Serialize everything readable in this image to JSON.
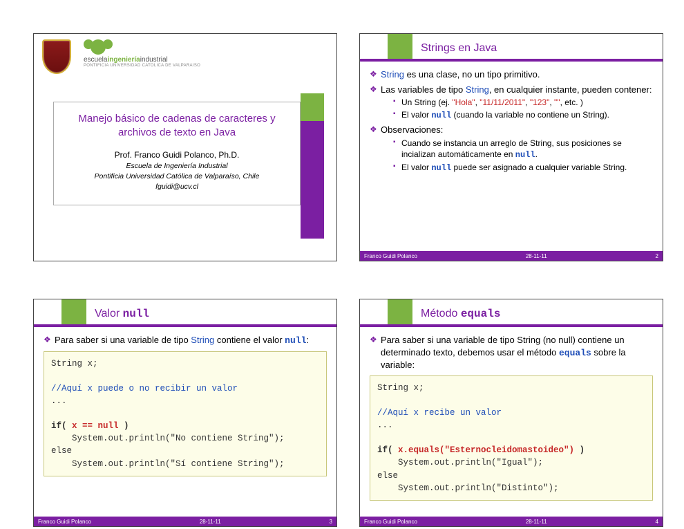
{
  "slide1": {
    "logo_text_prefix": "escuela",
    "logo_text_hi": "ingeniería",
    "logo_text_suffix": "industrial",
    "logo_sub": "PONTIFICIA UNIVERSIDAD CATOLICA DE VALPARAISO",
    "title_line1": "Manejo básico de cadenas de caracteres y",
    "title_line2": "archivos de texto en Java",
    "author": "Prof. Franco Guidi Polanco, Ph.D.",
    "aff1": "Escuela de Ingeniería Industrial",
    "aff2": "Pontificia Universidad Católica de Valparaíso, Chile",
    "email": "fguidi@ucv.cl"
  },
  "slide2": {
    "title": "Strings en Java",
    "b1_pre": "String",
    "b1_post": " es una clase, no un tipo primitivo.",
    "b2_pre": "Las variables de tipo ",
    "b2_mid": "String",
    "b2_post": ", en cualquier instante, pueden contener:",
    "b2s1_pre": "Un String (ej. ",
    "b2s1_q1": "\"Hola\"",
    "b2s1_sep1": ", ",
    "b2s1_q2": "\"11/11/2011\"",
    "b2s1_sep2": ", ",
    "b2s1_q3": "\"123\"",
    "b2s1_sep3": ", ",
    "b2s1_q4": "\"\"",
    "b2s1_post": ", etc. )",
    "b2s2_pre": "El valor ",
    "b2s2_code": "null",
    "b2s2_post": " (cuando la variable no contiene un String).",
    "b3": "Observaciones:",
    "b3s1_pre": "Cuando se instancia un arreglo de String, sus posiciones se incializan automáticamente en ",
    "b3s1_code": "null",
    "b3s1_post": ".",
    "b3s2_pre": "El valor ",
    "b3s2_code": "null",
    "b3s2_post": " puede ser asignado a cualquier variable String."
  },
  "slide3": {
    "title_pre": "Valor ",
    "title_code": "null",
    "b1_pre": "Para saber si una variable de tipo ",
    "b1_mid": "String",
    "b1_post": " contiene el valor ",
    "b1_code": "null",
    "b1_end": ":",
    "code_l1": "String x;",
    "code_l2": "//Aquí x puede o no recibir un valor",
    "code_l3": "...",
    "code_l4_kw": "if( ",
    "code_l4_hl": "x == null",
    "code_l4_end": " )",
    "code_l5": "    System.out.println(\"No contiene String\");",
    "code_l6": "else",
    "code_l7": "    System.out.println(\"Sí contiene String\");"
  },
  "slide4": {
    "title_pre": "Método ",
    "title_code": "equals",
    "b1_pre": "Para saber si una variable de tipo String (no null) contiene un determinado texto, debemos usar el método ",
    "b1_code": "equals",
    "b1_post": " sobre la variable:",
    "code_l1": "String x;",
    "code_l2": "//Aquí x recibe un valor",
    "code_l3": "...",
    "code_l4_kw": "if( ",
    "code_l4_hl": "x.equals(\"Esternocleidomastoideo\")",
    "code_l4_end": " )",
    "code_l5": "    System.out.println(\"Igual\");",
    "code_l6": "else",
    "code_l7": "    System.out.println(\"Distinto\");"
  },
  "footer": {
    "author": "Franco Guidi Polanco",
    "date": "28-11-11"
  },
  "pages": {
    "p2": "2",
    "p3": "3",
    "p4": "4"
  }
}
